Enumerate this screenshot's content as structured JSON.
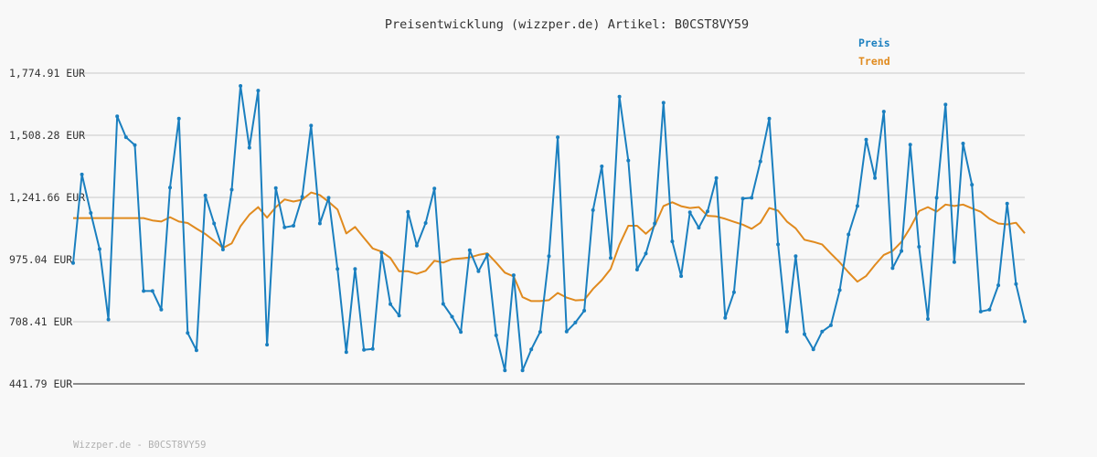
{
  "title": "Preisentwicklung (wizzper.de) Artikel: B0CST8VY59",
  "footer": "Wizzper.de - B0CST8VY59",
  "colors": {
    "preis": "#1a7fbf",
    "trend": "#e08a1e",
    "grid": "#e0e0e0",
    "axis": "#666666",
    "background": "#f8f8f8"
  },
  "chart_data": {
    "type": "line",
    "title": "Preisentwicklung (wizzper.de) Artikel: B0CST8VY59",
    "ylabel": "EUR",
    "ylim": [
      441.79,
      1774.91
    ],
    "yticks": [
      441.79,
      708.41,
      975.04,
      1241.66,
      1508.28,
      1774.91
    ],
    "ytick_labels": [
      "441.79 EUR",
      "708.41 EUR",
      "975.04 EUR",
      "1,241.66 EUR",
      "1,508.28 EUR",
      "1,774.91 EUR"
    ],
    "legend_position": "top-right",
    "grid": true,
    "series": [
      {
        "name": "Preis",
        "values": [
          960,
          1340,
          1175,
          1020,
          718,
          1590,
          1500,
          1466,
          840,
          840,
          760,
          1284,
          1580,
          660,
          586,
          1250,
          1130,
          1018,
          1275,
          1720,
          1455,
          1700,
          610,
          1282,
          1113,
          1120,
          1244,
          1550,
          1130,
          1240,
          935,
          578,
          935,
          588,
          592,
          1005,
          784,
          735,
          1180,
          1035,
          1132,
          1280,
          785,
          730,
          664,
          1015,
          925,
          995,
          650,
          500,
          908,
          500,
          590,
          665,
          990,
          1500,
          666,
          705,
          756,
          1187,
          1375,
          982,
          1674,
          1400,
          932,
          1001,
          1130,
          1648,
          1053,
          904,
          1178,
          1112,
          1182,
          1325,
          725,
          835,
          1237,
          1240,
          1396,
          1580,
          1040,
          666,
          990,
          655,
          590,
          666,
          693,
          844,
          1083,
          1205,
          1490,
          1325,
          1610,
          938,
          1012,
          1468,
          1030,
          720,
          1240,
          1640,
          964,
          1473,
          1296,
          752,
          760,
          865,
          1215,
          870,
          710
        ]
      },
      {
        "name": "Trend",
        "values": [
          1153,
          1153,
          1153,
          1153,
          1153,
          1153,
          1153,
          1153,
          1153,
          1143,
          1138,
          1157,
          1138,
          1132,
          1108,
          1085,
          1056,
          1025,
          1045,
          1118,
          1168,
          1200,
          1155,
          1200,
          1233,
          1224,
          1232,
          1263,
          1252,
          1223,
          1190,
          1087,
          1115,
          1068,
          1023,
          1009,
          982,
          925,
          925,
          914,
          927,
          970,
          962,
          977,
          980,
          984,
          995,
          1002,
          962,
          919,
          903,
          814,
          797,
          797,
          801,
          832,
          812,
          800,
          802,
          849,
          887,
          935,
          1039,
          1120,
          1120,
          1086,
          1120,
          1205,
          1221,
          1204,
          1196,
          1200,
          1163,
          1160,
          1150,
          1137,
          1125,
          1107,
          1133,
          1196,
          1185,
          1138,
          1109,
          1060,
          1051,
          1040,
          1001,
          963,
          920,
          880,
          905,
          952,
          995,
          1012,
          1051,
          1112,
          1183,
          1200,
          1181,
          1211,
          1205,
          1211,
          1195,
          1180,
          1150,
          1130,
          1126,
          1133,
          1088
        ]
      }
    ]
  }
}
